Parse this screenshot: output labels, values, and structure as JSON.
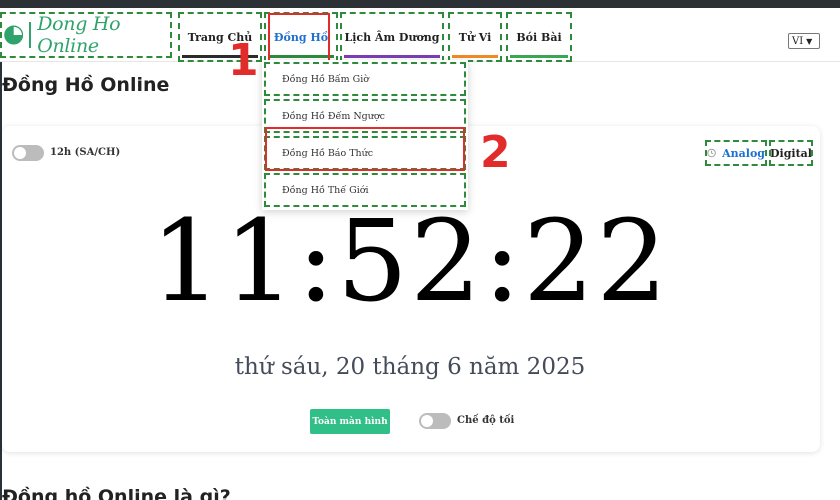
{
  "brand": {
    "name": "Dong Ho Online"
  },
  "nav": {
    "items": [
      {
        "label": "Trang Chủ"
      },
      {
        "label": "Đồng Hồ"
      },
      {
        "label": "Lịch Âm Dương"
      },
      {
        "label": "Tử Vi"
      },
      {
        "label": "Bói Bài"
      }
    ],
    "underline_colors": [
      "#2b2b2b",
      "#2e8b3c",
      "#7a3fb5",
      "#f08a24",
      "#3aa655"
    ],
    "dropdown": [
      {
        "label": "Đồng Hồ Bấm Giờ"
      },
      {
        "label": "Đồng Hồ Đếm Ngược"
      },
      {
        "label": "Đồng Hồ Báo Thức"
      },
      {
        "label": "Đồng Hồ Thế Giới"
      }
    ]
  },
  "language": {
    "selected": "VI"
  },
  "page": {
    "title": "Đồng Hồ Online"
  },
  "clock": {
    "format_toggle_label": "12h (SA/CH)",
    "mode_analog": "Analog",
    "mode_digital": "Digital",
    "time": "11:52:22",
    "date": "thứ sáu, 20 tháng 6 năm 2025",
    "fullscreen_label": "Toàn màn hình",
    "dark_mode_label": "Chế độ tối"
  },
  "annotations": {
    "step1": "1",
    "step2": "2"
  },
  "section": {
    "heading": "Đồng hồ Online là gì?"
  },
  "colors": {
    "accent": "#2fa36b",
    "link": "#1f6fd1",
    "highlight": "#e22b2b",
    "button": "#2fbf87"
  }
}
